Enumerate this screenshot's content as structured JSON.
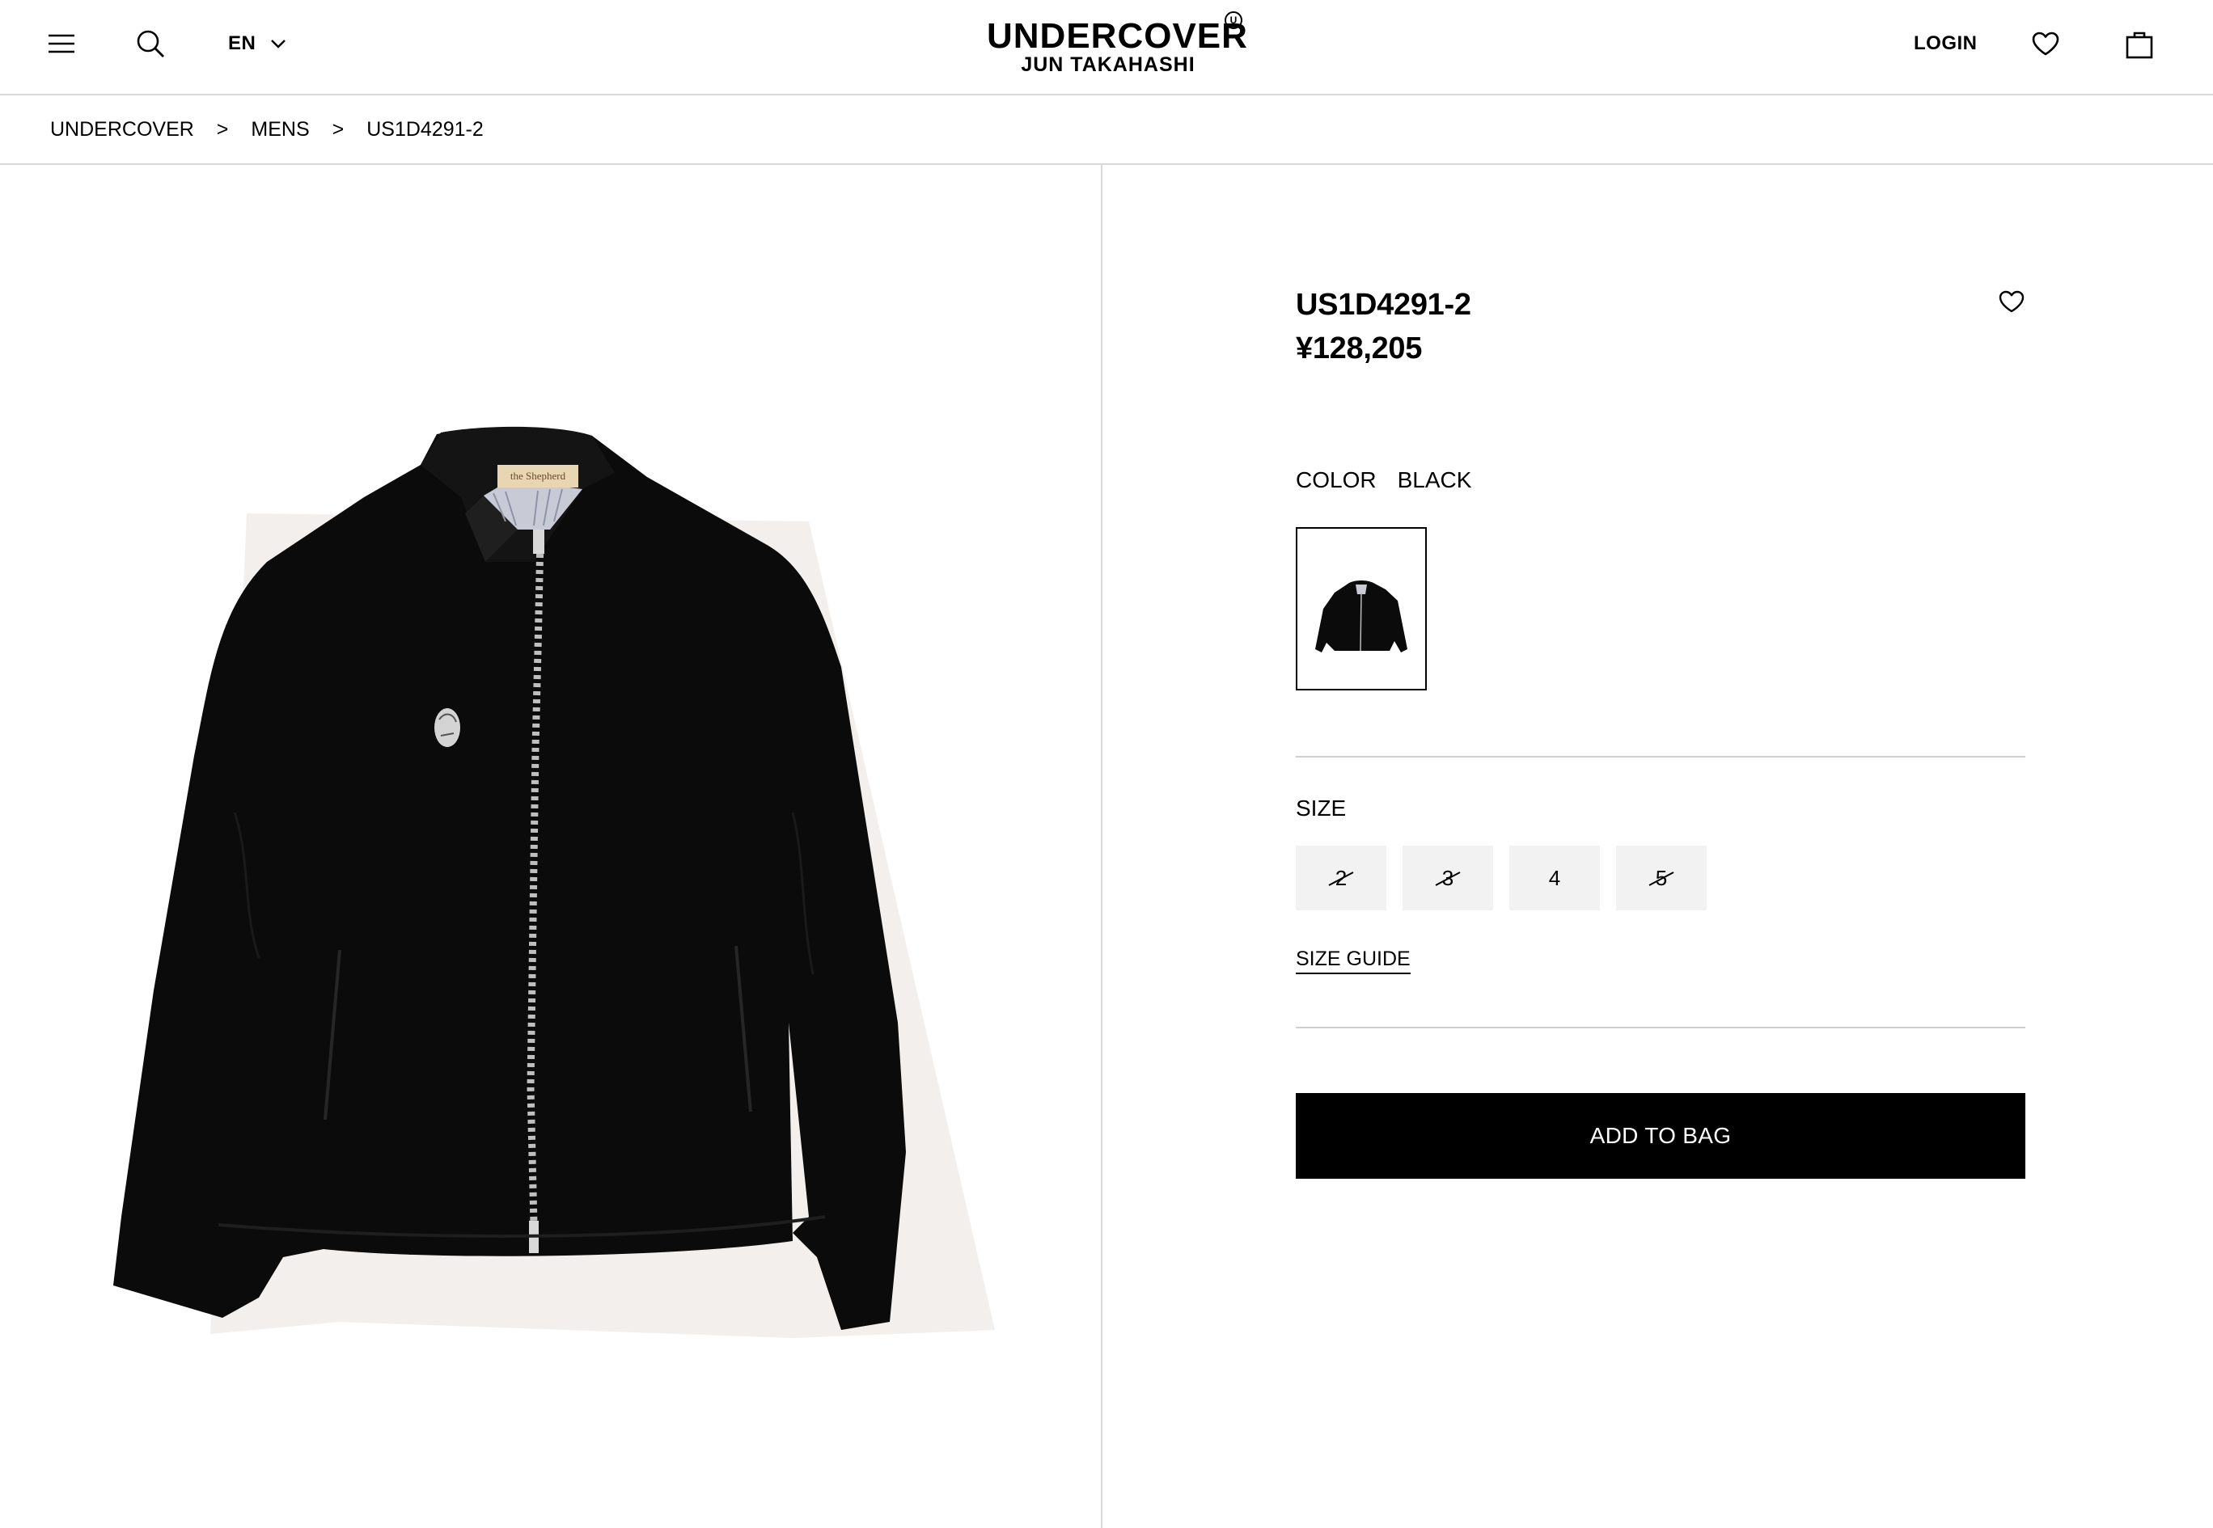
{
  "header": {
    "language": "EN",
    "logo_line1": "UNDERCOVER",
    "logo_line2": "JUN TAKAHASHI",
    "logo_mark": "U",
    "login_label": "LOGIN",
    "icons": [
      "menu-icon",
      "search-icon",
      "chevron-down-icon",
      "heart-icon",
      "bag-icon"
    ]
  },
  "breadcrumb": {
    "items": [
      "UNDERCOVER",
      "MENS",
      "US1D4291-2"
    ],
    "separator": ">"
  },
  "product": {
    "code": "US1D4291-2",
    "price": "¥128,205",
    "color_label": "COLOR",
    "color_value": "BLACK",
    "size_label": "SIZE",
    "sizes": [
      {
        "label": "2",
        "available": false
      },
      {
        "label": "3",
        "available": false
      },
      {
        "label": "4",
        "available": true
      },
      {
        "label": "5",
        "available": false
      }
    ],
    "size_guide_label": "SIZE GUIDE",
    "add_to_bag_label": "ADD TO BAG",
    "collar_label_text": "the Shepherd"
  },
  "colors": {
    "accent": "#000000",
    "divider": "#d9d9d9",
    "size_bg": "#f2f2f2"
  }
}
